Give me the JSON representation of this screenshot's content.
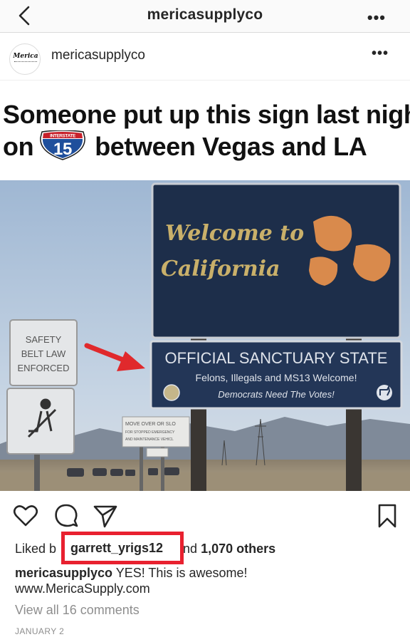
{
  "nav": {
    "title": "mericasupplyco",
    "back_icon": "chevron-left-icon",
    "more_label": "•••"
  },
  "post": {
    "avatar_text": "Merica",
    "username": "mericasupplyco",
    "more_label": "•••"
  },
  "meme": {
    "line1": "Someone put up this sign last night",
    "line2_pre": "on",
    "shield_top": "INTERSTATE",
    "shield_number": "15",
    "line2_post": "between Vegas and LA"
  },
  "photo": {
    "welcome_line1": "Welcome to",
    "welcome_line2": "California",
    "sanctuary_title": "OFFICIAL SANCTUARY STATE",
    "sanctuary_sub": "Felons, Illegals and MS13 Welcome!",
    "sanctuary_tag": "Democrats Need The Votes!",
    "safety_sign": [
      "SAFETY",
      "BELT LAW",
      "ENFORCED"
    ],
    "move_over_sign": [
      "MOVE OVER OR SLO",
      "FOR STOPPED EMERGENCY",
      "AND MAINTENANCE VEHICL"
    ],
    "colors": {
      "sky": "#b9cbe0",
      "sign_blue": "#233657",
      "poppy": "#d98a4c",
      "arrow": "#e0292c"
    }
  },
  "actions": {
    "like_icon": "heart-icon",
    "comment_icon": "comment-icon",
    "share_icon": "paper-plane-icon",
    "save_icon": "bookmark-icon"
  },
  "likes": {
    "prefix": "Liked b",
    "highlighted_user": "garrett_yrigs12",
    "suffix_pre": "nd ",
    "others": "1,070 others"
  },
  "caption": {
    "username": "mericasupplyco",
    "text": " YES! This is awesome!",
    "link": "www.MericaSupply.com"
  },
  "comments_link": "View all 16 comments",
  "date": "JANUARY 2",
  "highlight_color": "#e8212f"
}
